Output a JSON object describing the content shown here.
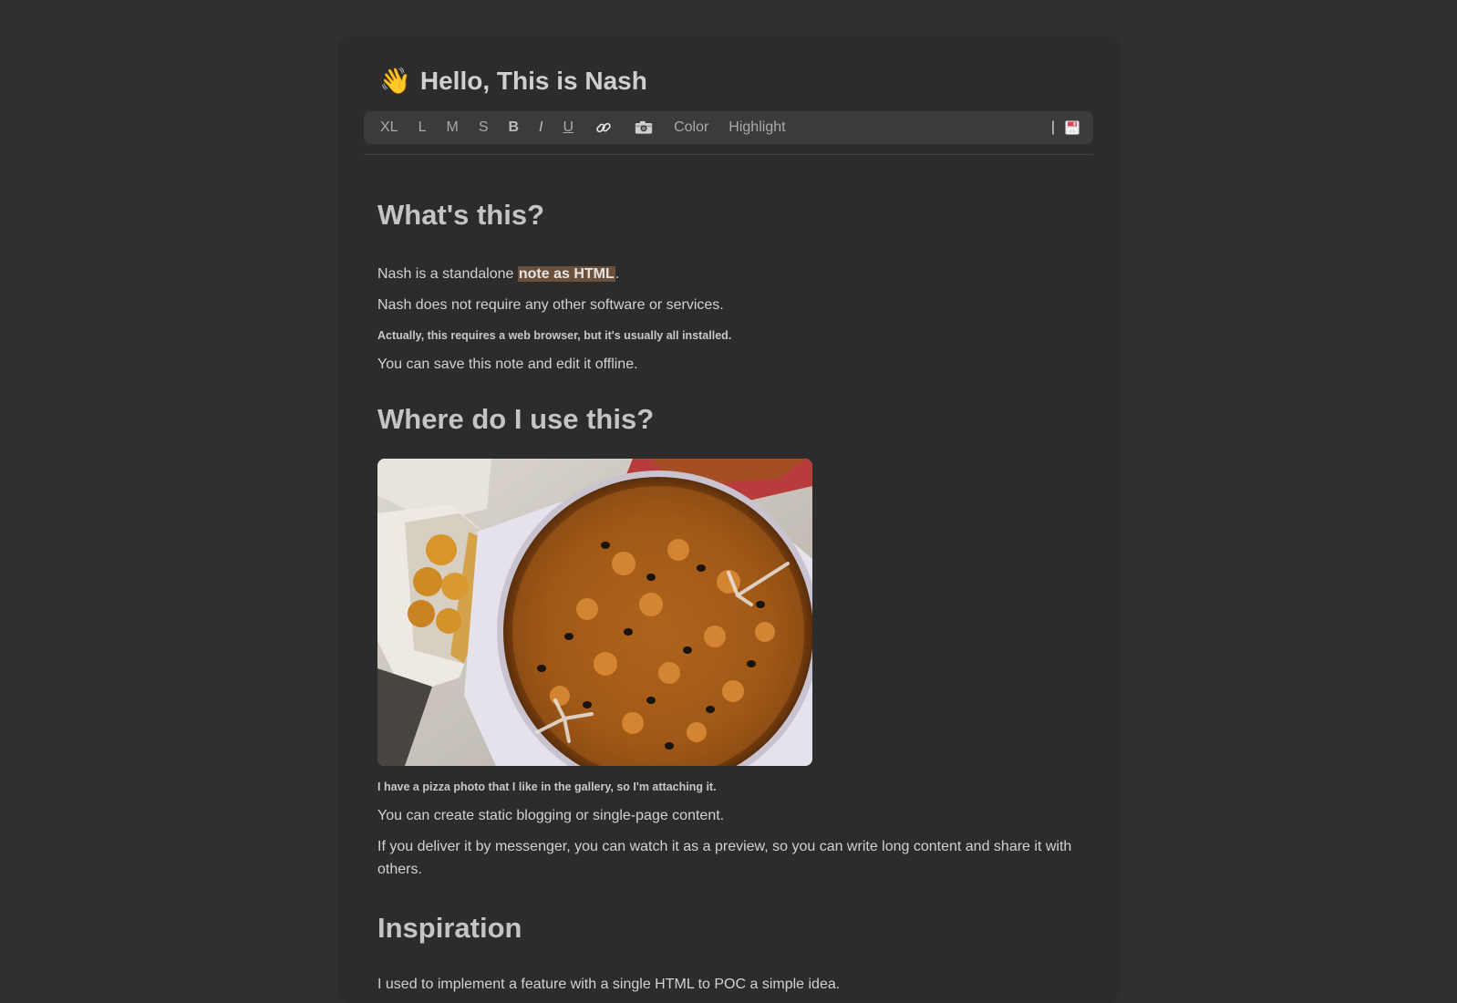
{
  "header": {
    "emoji": "👋",
    "title": "Hello, This is Nash"
  },
  "toolbar": {
    "xl": "XL",
    "l": "L",
    "m": "M",
    "s": "S",
    "bold": "B",
    "italic": "I",
    "underline": "U",
    "link_icon": "link-icon",
    "photo_icon": "camera-icon",
    "color": "Color",
    "highlight": "Highlight",
    "separator": "|",
    "save_icon": "floppy-disk-icon"
  },
  "content": {
    "h_whats_this": "What's this?",
    "p1_before": "Nash is a standalone ",
    "p1_highlight": "note as HTML",
    "p1_after": ".",
    "p2": "Nash does not require any other software or services.",
    "p3_small": "Actually, this requires a web browser, but it's usually all installed.",
    "p4": "You can save this note and edit it offline.",
    "h_where": "Where do I use this?",
    "image_caption": "I have a pizza photo that I like in the gallery, so I'm attaching it.",
    "p5": "You can create static blogging or single-page content.",
    "p6": "If you deliver it by messenger, you can watch it as a preview, so you can write long content and share it with others.",
    "h_inspiration": "Inspiration",
    "p7": "I used to implement a feature with a single HTML to POC a simple idea."
  },
  "colors": {
    "page_bg": "#303030",
    "sheet_bg": "#2c2c2c",
    "toolbar_bg": "#3b3b3b",
    "highlight_bg": "#6b513b"
  }
}
